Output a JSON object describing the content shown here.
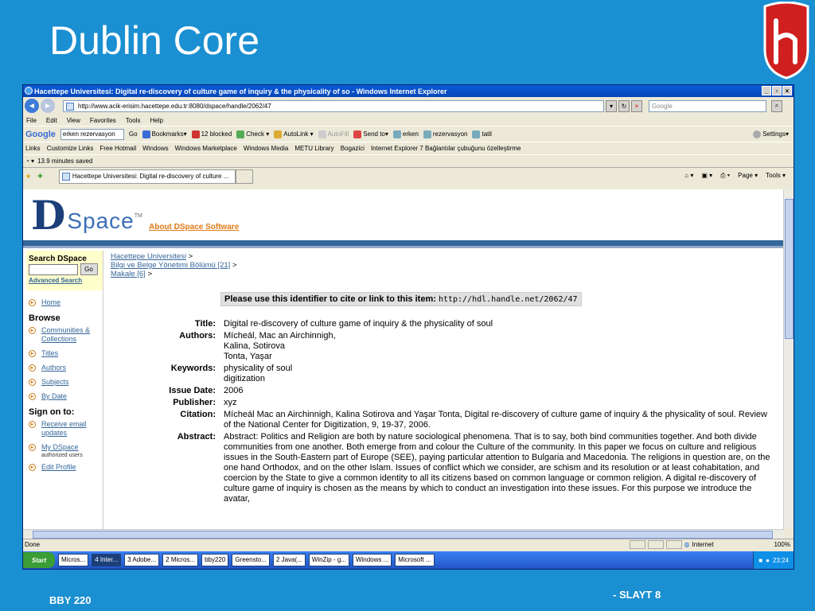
{
  "slide": {
    "title": "Dublin Core",
    "footer_left": "BBY 220",
    "footer_right": "- SLAYT 8"
  },
  "browser": {
    "window_title": "Hacettepe Universitesi: Digital re-discovery of culture game of inquiry & the physicality of so - Windows Internet Explorer",
    "address": "http://www.acik-erisim.hacettepe.edu.tr:8080/dspace/handle/2062/47",
    "search_placeholder": "Google",
    "menu": [
      "File",
      "Edit",
      "View",
      "Favorites",
      "Tools",
      "Help"
    ],
    "google_label": "Google",
    "google_query": "erken rezervasyon",
    "toolbar_go": "Go",
    "toolbar_items": [
      "Bookmarks▾",
      "12 blocked",
      "Check ▾",
      "AutoLink ▾",
      "AutoFill",
      "Send to▾",
      "erken",
      "rezervasyon",
      "tatil"
    ],
    "settings": "Settings▾",
    "links_label": "Links",
    "links": [
      "Customize Links",
      "Free Hotmail",
      "Windows",
      "Windows Marketplace",
      "Windows Media",
      "METU Library",
      "Bogazici",
      "Internet Explorer 7 Bağlantılar çubuğunu özelleştirme"
    ],
    "saved": "13.9 minutes saved",
    "tab_title": "Hacettepe Universitesi: Digital re-discovery of culture ...",
    "tab_tools": [
      "Page ▾",
      "Tools ▾"
    ],
    "status": "Done",
    "zone": "Internet",
    "zoom": "100%"
  },
  "dspace": {
    "logo_d": "D",
    "logo_space": "Space",
    "logo_tm": "TM",
    "about": "About DSpace Software",
    "search_heading": "Search DSpace",
    "go": "Go",
    "advanced": "Advanced Search",
    "home": "Home",
    "browse_heading": "Browse",
    "browse_links": [
      "Communities & Collections",
      "Titles",
      "Authors",
      "Subjects",
      "By Date"
    ],
    "signon_heading": "Sign on to:",
    "signon_links": [
      "Receive email updates",
      "My DSpace",
      "Edit Profile"
    ],
    "authorized": "authorized users",
    "breadcrumbs": [
      "Hacettepe Universitesi",
      "Bilgi ve Belge Yönetimi Bölümü [21]",
      "Makale [6]"
    ],
    "cite_label": "Please use this identifier to cite or link to this item:",
    "cite_url": "http://hdl.handle.net/2062/47",
    "fields": [
      {
        "label": "Title:",
        "value": "Digital re-discovery of culture game of inquiry & the physicality of soul"
      },
      {
        "label": "Authors:",
        "value": "Mícheál, Mac an Airchinnigh,\nKalina, Sotirova\nTonta, Yaşar"
      },
      {
        "label": "Keywords:",
        "value": "physicality of soul\ndigitization"
      },
      {
        "label": "Issue Date:",
        "value": "2006"
      },
      {
        "label": "Publisher:",
        "value": "xyz"
      },
      {
        "label": "Citation:",
        "value": "Mícheál Mac an Airchinnigh, Kalina Sotirova and Yaşar Tonta, Digital re-discovery of culture game of inquiry & the physicality of soul. Review of the National Center for Digitization, 9, 19-37, 2006."
      },
      {
        "label": "Abstract:",
        "value": "Abstract: Politics and Religion are both by nature sociological phenomena. That is to say, both bind communities together. And both divide communities from one another. Both emerge from and colour the Culture of the community. In this paper we focus on culture and religious issues in the South-Eastern part of Europe (SEE), paying particular attention to Bulgaria and Macedonia. The religions in question are, on the one hand Orthodox, and on the other Islam. Issues of conflict which we consider, are schism and its resolution or at least cohabitation, and coercion by the State to give a common identity to all its citizens based on common language or common religion. A digital re-discovery of culture game of inquiry is chosen as the means by which to conduct an investigation into these issues. For this purpose we introduce the avatar,"
      }
    ]
  },
  "taskbar": {
    "start": "Start",
    "tasks": [
      "Micros...",
      "4 Inter...",
      "3 Adobe...",
      "2 Micros...",
      "bby220",
      "Greensto...",
      "2 Java(...",
      "WinZip - g...",
      "Windows ...",
      "Microsoft ..."
    ],
    "clock": "23:24"
  }
}
